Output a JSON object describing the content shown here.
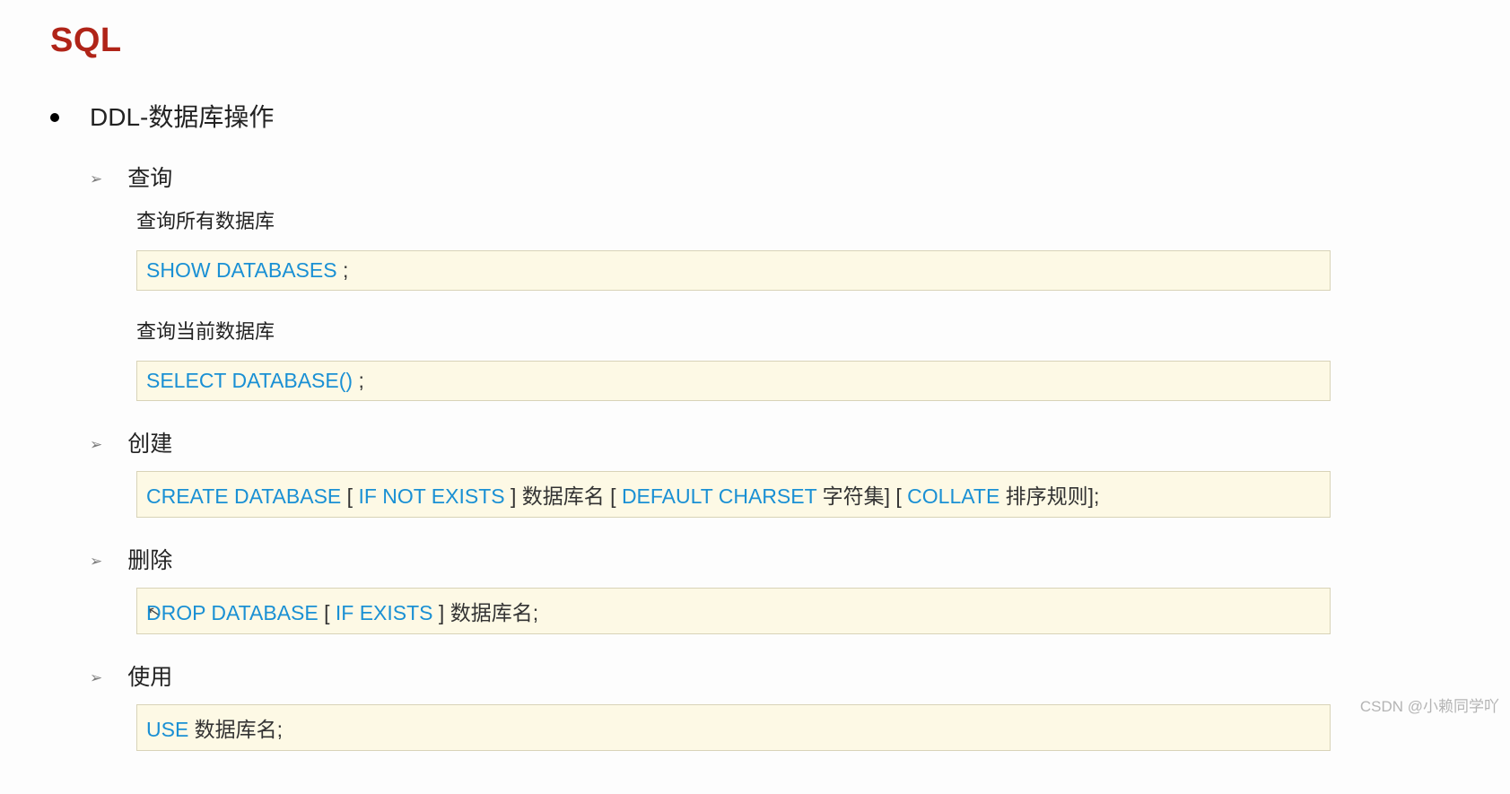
{
  "title": "SQL",
  "topic": "DDL-数据库操作",
  "sections": [
    {
      "heading": "查询",
      "items": [
        {
          "label": "查询所有数据库",
          "code": [
            {
              "k": true,
              "t": "SHOW DATABASES"
            },
            {
              "k": false,
              "t": " ;"
            }
          ]
        },
        {
          "label": "查询当前数据库",
          "code": [
            {
              "k": true,
              "t": "SELECT DATABASE()"
            },
            {
              "k": false,
              "t": " ;"
            }
          ]
        }
      ]
    },
    {
      "heading": "创建",
      "items": [
        {
          "label": null,
          "code": [
            {
              "k": true,
              "t": "CREATE DATABASE "
            },
            {
              "k": false,
              "t": "[ "
            },
            {
              "k": true,
              "t": "IF NOT EXISTS"
            },
            {
              "k": false,
              "t": " ] 数据库名  [ "
            },
            {
              "k": true,
              "t": "DEFAULT CHARSET"
            },
            {
              "k": false,
              "t": " 字符集]  [ "
            },
            {
              "k": true,
              "t": "COLLATE"
            },
            {
              "k": false,
              "t": "  排序规则];"
            }
          ]
        }
      ]
    },
    {
      "heading": "删除",
      "items": [
        {
          "label": null,
          "code": [
            {
              "k": true,
              "t": "DROP DATABASE"
            },
            {
              "k": false,
              "t": " [ "
            },
            {
              "k": true,
              "t": "IF EXISTS"
            },
            {
              "k": false,
              "t": " ] 数据库名;"
            }
          ]
        }
      ]
    },
    {
      "heading": "使用",
      "items": [
        {
          "label": null,
          "code": [
            {
              "k": true,
              "t": "USE"
            },
            {
              "k": false,
              "t": "  数据库名;"
            }
          ]
        }
      ]
    }
  ],
  "watermark": "CSDN @小赖同学吖"
}
